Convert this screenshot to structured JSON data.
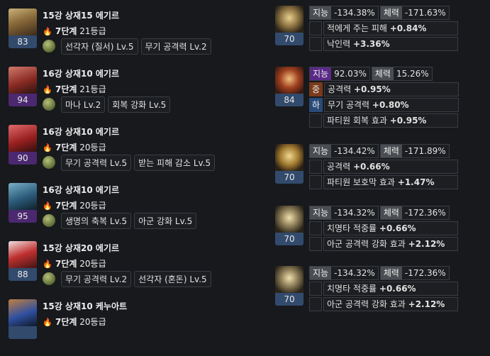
{
  "equipment": [
    {
      "title": "15강 상재15 에기르",
      "level": "83",
      "level_grade": "blue",
      "stage": "7단계",
      "stage_grade": "21등급",
      "subs": [
        "선각자 (질서) Lv.5",
        "무기 공격력 Lv.2"
      ],
      "icon": "helmet-icon"
    },
    {
      "title": "16강 상재10 에기르",
      "level": "94",
      "level_grade": "purple",
      "stage": "7단계",
      "stage_grade": "21등급",
      "subs": [
        "마나 Lv.2",
        "회복 강화 Lv.5"
      ],
      "icon": "shoulder-armor-icon"
    },
    {
      "title": "16강 상재10 에기르",
      "level": "90",
      "level_grade": "purple",
      "stage": "7단계",
      "stage_grade": "20등급",
      "subs": [
        "무기 공격력 Lv.5",
        "받는 피해 감소 Lv.5"
      ],
      "icon": "chest-armor-icon"
    },
    {
      "title": "16강 상재10 에기르",
      "level": "95",
      "level_grade": "purple",
      "stage": "7단계",
      "stage_grade": "20등급",
      "subs": [
        "생명의 축복 Lv.5",
        "아군 강화 Lv.5"
      ],
      "icon": "pants-icon"
    },
    {
      "title": "15강 상재20 에기르",
      "level": "88",
      "level_grade": "blue",
      "stage": "7단계",
      "stage_grade": "20등급",
      "subs": [
        "무기 공격력 Lv.2",
        "선각자 (혼돈) Lv.5"
      ],
      "icon": "gloves-icon"
    },
    {
      "title": "15강 상재10 케누아트",
      "level": "",
      "level_grade": "blue",
      "stage": "7단계",
      "stage_grade": "20등급",
      "subs": [],
      "icon": "weapon-staff-icon"
    }
  ],
  "accessories": [
    {
      "level": "70",
      "icon": "necklace-icon",
      "stats": [
        {
          "label": "지능",
          "value": "-134.38%"
        },
        {
          "label": "체력",
          "value": "-171.63%"
        }
      ],
      "effects": [
        {
          "grade": "",
          "name": "적에게 주는 피해",
          "value": "+0.84%"
        },
        {
          "grade": "",
          "name": "낙인력",
          "value": "+3.36%"
        }
      ]
    },
    {
      "level": "84",
      "icon": "ability-stone-icon",
      "stats": [
        {
          "label": "지능",
          "value": "92.03%"
        },
        {
          "label": "체력",
          "value": "15.26%"
        }
      ],
      "effects": [
        {
          "grade": "중",
          "name": "공격력",
          "value": "+0.95%"
        },
        {
          "grade": "하",
          "name": "무기 공격력",
          "value": "+0.80%"
        },
        {
          "grade": "",
          "name": "파티원 회복 효과",
          "value": "+0.95%"
        }
      ]
    },
    {
      "level": "70",
      "icon": "earring-icon",
      "stats": [
        {
          "label": "지능",
          "value": "-134.42%"
        },
        {
          "label": "체력",
          "value": "-171.89%"
        }
      ],
      "effects": [
        {
          "grade": "",
          "name": "공격력",
          "value": "+0.66%"
        },
        {
          "grade": "",
          "name": "파티원 보호막 효과",
          "value": "+1.47%"
        }
      ]
    },
    {
      "level": "70",
      "icon": "ring-icon",
      "stats": [
        {
          "label": "지능",
          "value": "-134.32%"
        },
        {
          "label": "체력",
          "value": "-172.36%"
        }
      ],
      "effects": [
        {
          "grade": "",
          "name": "치명타 적중률",
          "value": "+0.66%"
        },
        {
          "grade": "",
          "name": "아군 공격력 강화 효과",
          "value": "+2.12%"
        }
      ]
    },
    {
      "level": "70",
      "icon": "ring-icon",
      "stats": [
        {
          "label": "지능",
          "value": "-134.32%"
        },
        {
          "label": "체력",
          "value": "-172.36%"
        }
      ],
      "effects": [
        {
          "grade": "",
          "name": "치명타 적중률",
          "value": "+0.66%"
        },
        {
          "grade": "",
          "name": "아군 공격력 강화 효과",
          "value": "+2.12%"
        }
      ]
    }
  ],
  "colors": {
    "background": "#17191d",
    "level_blue": "#324a6c",
    "level_purple": "#4b2870",
    "flame": "#f0a030"
  }
}
